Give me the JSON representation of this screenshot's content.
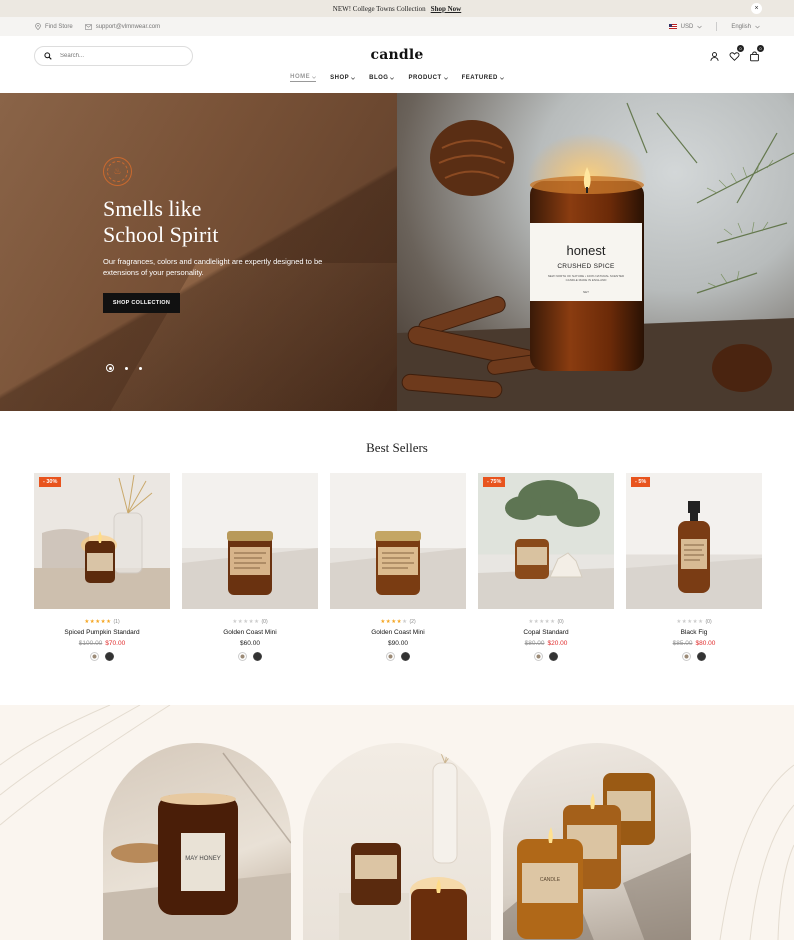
{
  "announcement": {
    "text": "NEW! College Towns Collection",
    "link": "Shop Now",
    "close": "×"
  },
  "infobar": {
    "store": "Find Store",
    "email": "support@vlmnwear.com",
    "currency": "USD",
    "language": "English"
  },
  "header": {
    "search_placeholder": "Search...",
    "logo": "candle",
    "wishlist_count": "0",
    "cart_count": "0",
    "nav": [
      "HOME",
      "SHOP",
      "BLOG",
      "PRODUCT",
      "FEATURED"
    ]
  },
  "hero": {
    "title_line1": "Smells like",
    "title_line2": "School Spirit",
    "description": "Our fragrances, colors and candlelight are expertly designed to be extensions of your personality.",
    "button": "SHOP COLLECTION",
    "candle_brand": "honest",
    "candle_scent": "CRUSHED SPICE",
    "candle_fine": "NEW NORTH OF NATURE • 100% NATURAL SCENTED CANDLE MADE IN ENGLAND",
    "candle_weight": "NET",
    "slide_count": 3,
    "active_slide": 1
  },
  "best_sellers": {
    "title": "Best Sellers",
    "products": [
      {
        "name": "Spiced Pumpkin Standard",
        "rating": 5,
        "reviews": "(1)",
        "old_price": "$100.00",
        "price": "$70.00",
        "badge": "- 30%"
      },
      {
        "name": "Golden Coast Mini",
        "rating": 0,
        "reviews": "(0)",
        "old_price": "",
        "price": "$60.00",
        "badge": ""
      },
      {
        "name": "Golden Coast Mini",
        "rating": 4,
        "reviews": "(2)",
        "old_price": "",
        "price": "$90.00",
        "badge": ""
      },
      {
        "name": "Copal Standard",
        "rating": 0,
        "reviews": "(0)",
        "old_price": "$80.00",
        "price": "$20.00",
        "badge": "- 75%"
      },
      {
        "name": "Black Fig",
        "rating": 0,
        "reviews": "(0)",
        "old_price": "$85.00",
        "price": "$80.00",
        "badge": "- 5%"
      }
    ]
  },
  "collection": {
    "arch1_label": "MAY HONEY",
    "arch3_label": "CANDLE"
  },
  "colors": {
    "accent": "#e8541e",
    "sale_price": "#e02b2b",
    "hero_brown": "#7a5338",
    "seal": "#c9692e",
    "dark": "#111111"
  }
}
